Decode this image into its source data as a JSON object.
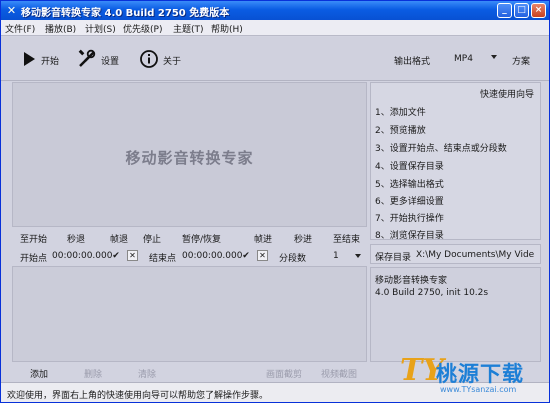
{
  "window": {
    "title": "移动影音转换专家 4.0 Build 2750 免费版本",
    "controls": {
      "minimize": "_",
      "maximize": "□",
      "close": "×"
    }
  },
  "menu": [
    "文件(F)",
    "播放(B)",
    "计划(S)",
    "优先级(P)",
    "主题(T)",
    "帮助(H)"
  ],
  "toolbar": {
    "start": "开始",
    "settings": "设置",
    "about": "关于",
    "output_format_label": "输出格式",
    "output_format_value": "MP4",
    "preset_label": "方案"
  },
  "preview": {
    "watermark": "移动影音转换专家"
  },
  "controls": [
    "至开始",
    "秒退",
    "帧退",
    "停止",
    "暂停/恢复",
    "帧进",
    "秒进",
    "至结束"
  ],
  "markers": {
    "start_label": "开始点",
    "start_time": "00:00:00.000",
    "end_label": "结束点",
    "end_time": "00:00:00.000",
    "segments_label": "分段数",
    "segments_value": "1"
  },
  "buttons": [
    "添加",
    "删除",
    "清除",
    "画面截剪",
    "视频截图"
  ],
  "guide": {
    "title": "快速使用向导",
    "steps": [
      "1、添加文件",
      "2、预览播放",
      "3、设置开始点、结束点或分段数",
      "4、设置保存目录",
      "5、选择输出格式",
      "6、更多详细设置",
      "7、开始执行操作",
      "8、浏览保存目录"
    ]
  },
  "save_dir": {
    "label": "保存目录",
    "path": "X:\\My Documents\\My Videos\\"
  },
  "info": {
    "name": "移动影音转换专家",
    "version": "4.0 Build 2750, init 10.2s"
  },
  "status": {
    "message": "欢迎使用，界面右上角的快速使用向导可以帮助您了解操作步骤。"
  },
  "logo": {
    "mark": "TY",
    "text": "桃源下载",
    "url": "www.TYsanzai.com"
  }
}
